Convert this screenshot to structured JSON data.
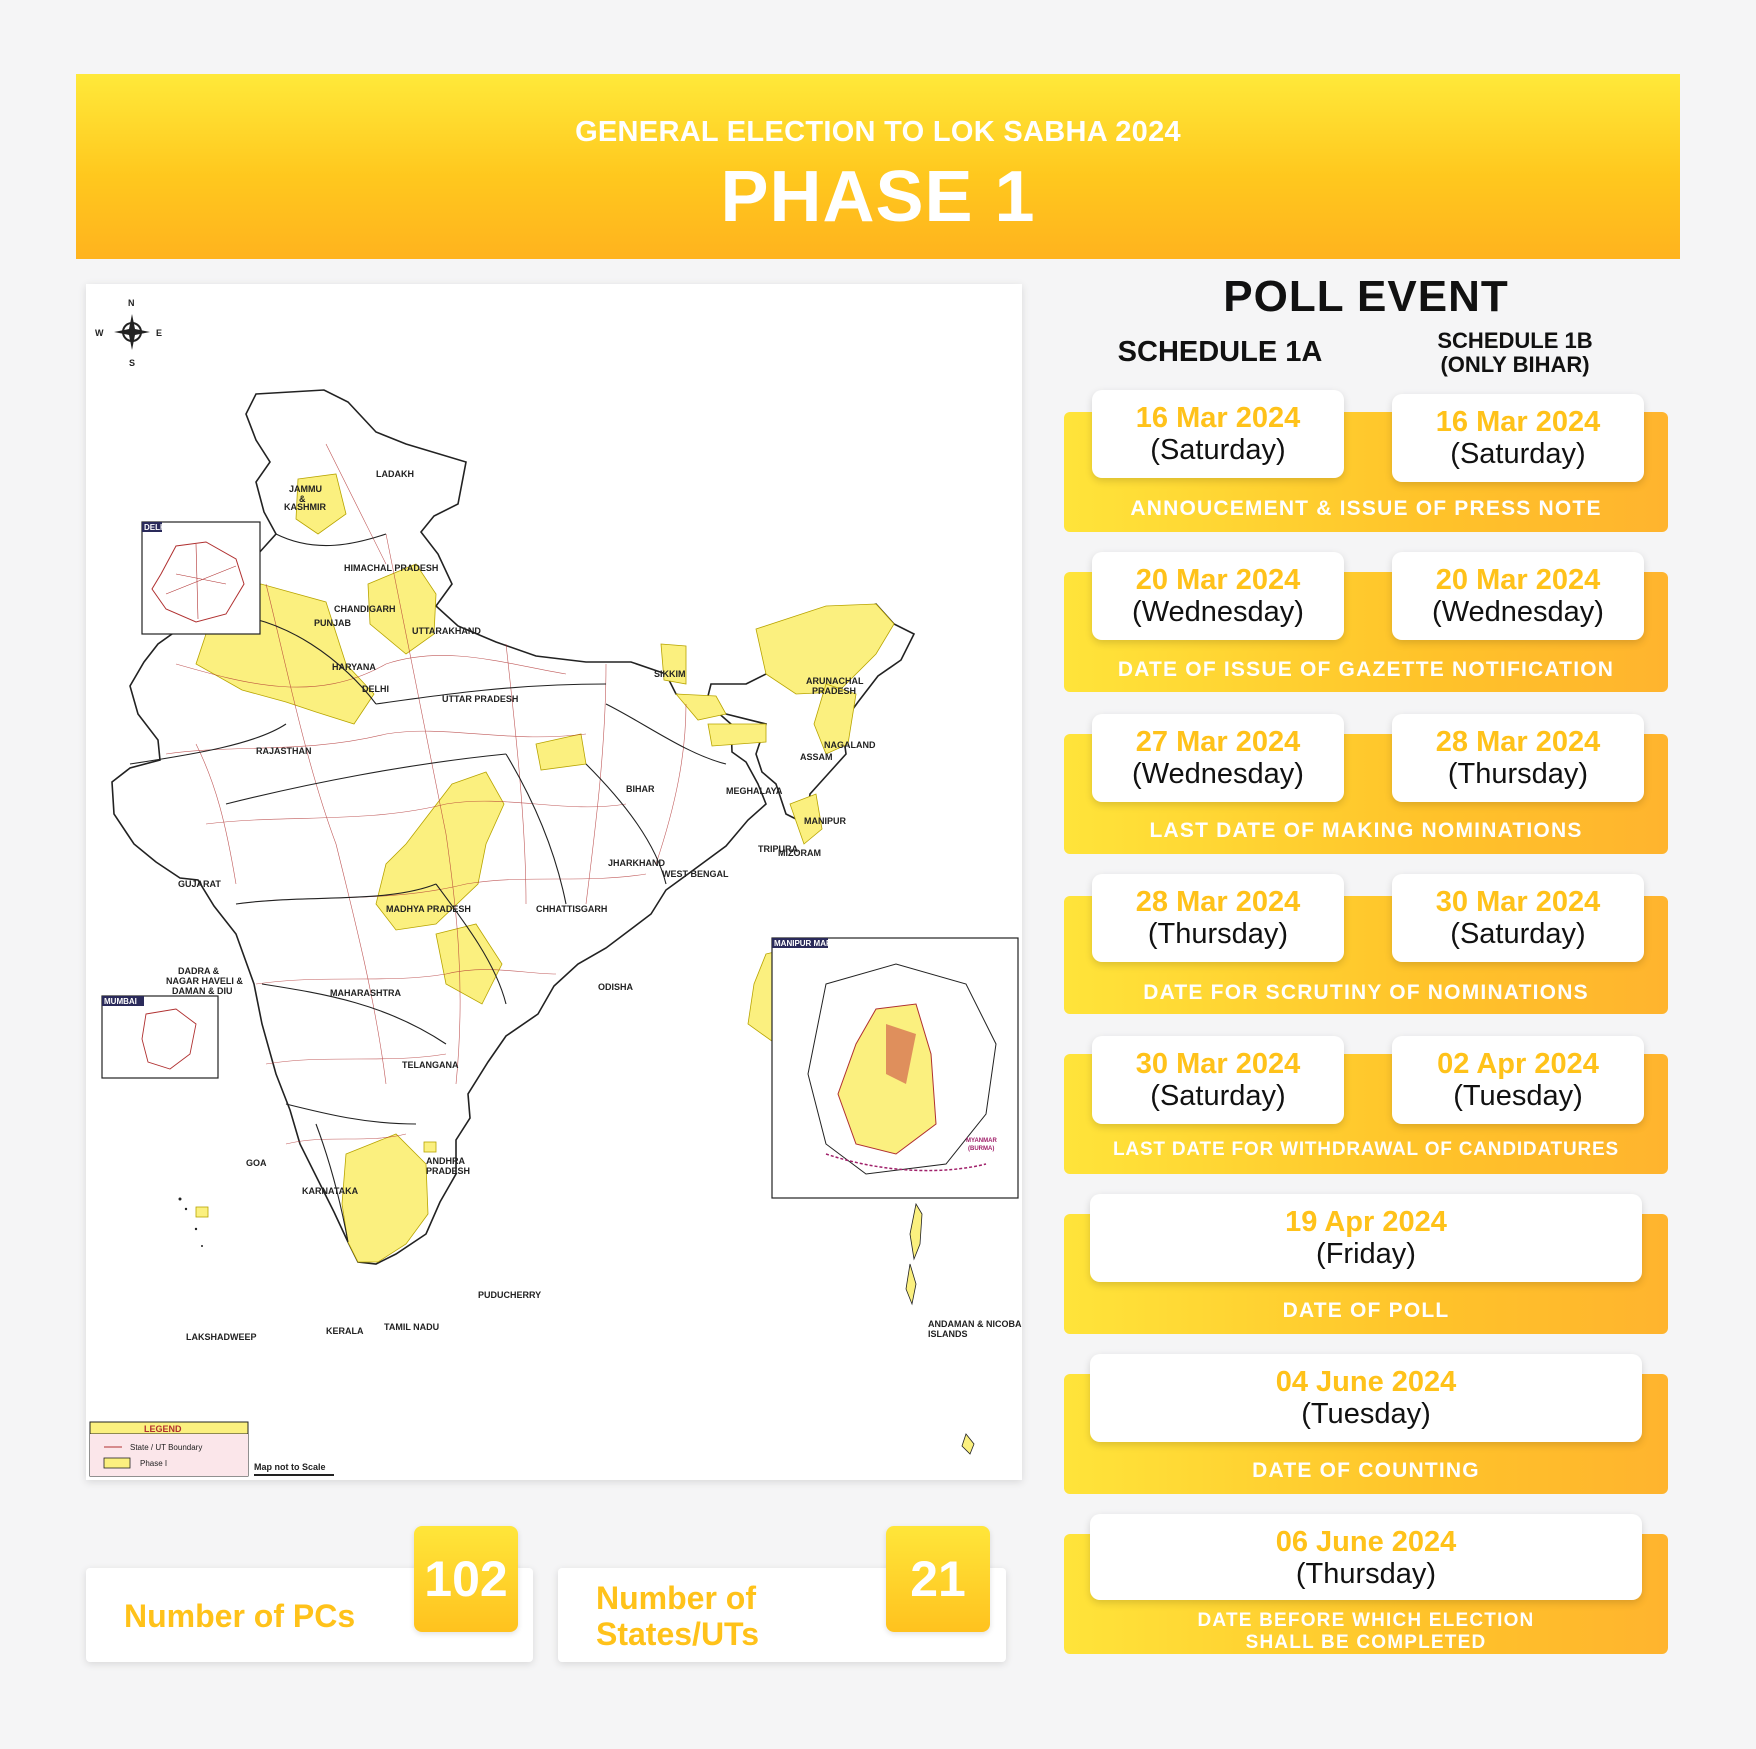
{
  "header": {
    "subtitle": "GENERAL ELECTION TO LOK SABHA 2024",
    "title": "PHASE 1"
  },
  "map": {
    "compass": {
      "n": "N",
      "s": "S",
      "e": "E",
      "w": "W"
    },
    "labels": {
      "ladakh": "LADAKH",
      "jammu": "JAMMU",
      "amp": "&",
      "kashmir": "KASHMIR",
      "himachal": "HIMACHAL PRADESH",
      "chandigarh": "CHANDIGARH",
      "punjab": "PUNJAB",
      "uttarakhand": "UTTARAKHAND",
      "haryana": "HARYANA",
      "delhi": "DELHI",
      "uttar_pradesh": "UTTAR PRADESH",
      "rajasthan": "RAJASTHAN",
      "sikkim": "SIKKIM",
      "arunachal": "ARUNACHAL",
      "arunachal2": "PRADESH",
      "assam": "ASSAM",
      "nagaland": "NAGALAND",
      "meghalaya": "MEGHALAYA",
      "bihar": "BIHAR",
      "manipur": "MANIPUR",
      "tripura": "TRIPURA",
      "mizoram": "MIZORAM",
      "jharkhand": "JHARKHAND",
      "west_bengal": "WEST BENGAL",
      "gujarat": "GUJARAT",
      "madhya_pradesh": "MADHYA PRADESH",
      "chhattisgarh": "CHHATTISGARH",
      "dadra1": "DADRA &",
      "dadra2": "NAGAR HAVELI &",
      "dadra3": "DAMAN & DIU",
      "maharashtra": "MAHARASHTRA",
      "odisha": "ODISHA",
      "telangana": "TELANGANA",
      "andhra1": "ANDHRA",
      "andhra2": "PRADESH",
      "goa": "GOA",
      "karnataka": "KARNATAKA",
      "puducherry": "PUDUCHERRY",
      "lakshadweep": "LAKSHADWEEP",
      "kerala": "KERALA",
      "tamil_nadu": "TAMIL NADU",
      "andaman1": "ANDAMAN & NICOBAR",
      "andaman2": "ISLANDS",
      "myanmar1": "MYANMAR",
      "myanmar2": "(BURMA)"
    },
    "insets": {
      "delhi": "DELHI",
      "mumbai": "MUMBAI",
      "manipur": "MANIPUR MAP"
    },
    "legend": {
      "title": "LEGEND",
      "boundary": "State / UT Boundary",
      "phase": "Phase I"
    },
    "scale_note": "Map not to Scale",
    "colors": {
      "phase": "#fbf07f",
      "boundary": "#b03030",
      "outline": "#222222"
    }
  },
  "stats": [
    {
      "label": "Number of PCs",
      "value": "102"
    },
    {
      "label": "Number of States/UTs",
      "value": "21"
    }
  ],
  "poll": {
    "title": "POLL EVENT",
    "schedule_a": "SCHEDULE 1A",
    "schedule_b_line1": "SCHEDULE 1B",
    "schedule_b_line2": "(ONLY BIHAR)",
    "events": [
      {
        "caption": "ANNOUCEMENT & ISSUE OF PRESS NOTE",
        "a_date": "16 Mar 2024",
        "a_day": "(Saturday)",
        "b_date": "16 Mar 2024",
        "b_day": "(Saturday)"
      },
      {
        "caption": "DATE OF ISSUE OF GAZETTE NOTIFICATION",
        "a_date": "20 Mar 2024",
        "a_day": "(Wednesday)",
        "b_date": "20 Mar 2024",
        "b_day": "(Wednesday)"
      },
      {
        "caption": "LAST DATE OF MAKING NOMINATIONS",
        "a_date": "27 Mar 2024",
        "a_day": "(Wednesday)",
        "b_date": "28 Mar 2024",
        "b_day": "(Thursday)"
      },
      {
        "caption": "DATE FOR SCRUTINY OF NOMINATIONS",
        "a_date": "28 Mar 2024",
        "a_day": "(Thursday)",
        "b_date": "30 Mar 2024",
        "b_day": "(Saturday)"
      },
      {
        "caption": "LAST DATE FOR WITHDRAWAL OF CANDIDATURES",
        "a_date": "30 Mar 2024",
        "a_day": "(Saturday)",
        "b_date": "02 Apr 2024",
        "b_day": "(Tuesday)"
      },
      {
        "caption": "DATE OF POLL",
        "date": "19 Apr 2024",
        "day": "(Friday)"
      },
      {
        "caption": "DATE OF COUNTING",
        "date": "04 June 2024",
        "day": "(Tuesday)"
      },
      {
        "caption_line1": "DATE BEFORE WHICH ELECTION",
        "caption_line2": "SHALL BE COMPLETED",
        "date": "06 June 2024",
        "day": "(Thursday)"
      }
    ]
  }
}
